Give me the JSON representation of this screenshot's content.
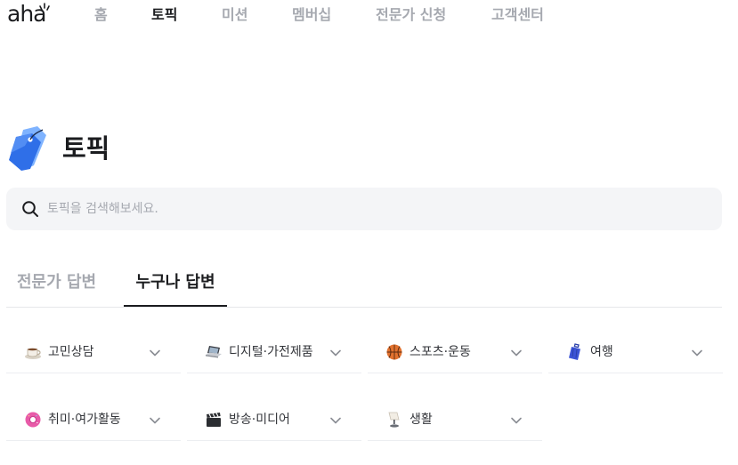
{
  "brand": {
    "logo_text": "aha"
  },
  "nav": {
    "items": [
      {
        "label": "홈",
        "active": false
      },
      {
        "label": "토픽",
        "active": true
      },
      {
        "label": "미션",
        "active": false
      },
      {
        "label": "멤버십",
        "active": false
      },
      {
        "label": "전문가 신청",
        "active": false
      },
      {
        "label": "고객센터",
        "active": false
      }
    ]
  },
  "page": {
    "title": "토픽",
    "icon": "tag-icon"
  },
  "search": {
    "placeholder": "토픽을 검색해보세요.",
    "value": "",
    "icon": "search-icon"
  },
  "tabs": [
    {
      "label": "전문가 답변",
      "active": false
    },
    {
      "label": "누구나 답변",
      "active": true
    }
  ],
  "categories": [
    {
      "label": "고민상담",
      "icon": "coffee-icon"
    },
    {
      "label": "디지털·가전제품",
      "icon": "laptop-icon"
    },
    {
      "label": "스포츠·운동",
      "icon": "basketball-icon"
    },
    {
      "label": "여행",
      "icon": "suitcase-icon"
    },
    {
      "label": "취미·여가활동",
      "icon": "donut-icon"
    },
    {
      "label": "방송·미디어",
      "icon": "clapperboard-icon"
    },
    {
      "label": "생활",
      "icon": "lamp-icon"
    }
  ],
  "colors": {
    "accent": "#1b1c1f",
    "muted": "#a6a9b0",
    "search_bg": "#f4f5f7",
    "tag_blue": "#2f6fe8"
  }
}
